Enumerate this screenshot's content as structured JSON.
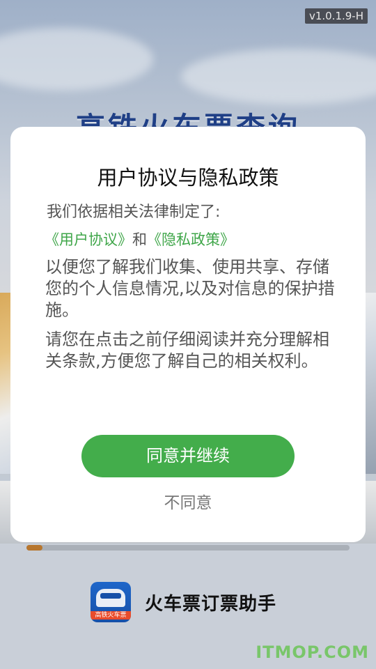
{
  "version": "v1.0.1.9-H",
  "background": {
    "title": "高铁火车票查询",
    "app_name": "火车票订票助手",
    "logo_label": "高铁火车票",
    "watermark": "ITMOP.COM",
    "progress": 0.05
  },
  "dialog": {
    "title": "用户协议与隐私政策",
    "intro": "我们依据相关法律制定了:",
    "user_agreement_link": "《用户协议》",
    "and_text": "和",
    "privacy_policy_link": "《隐私政策》",
    "paragraph1": "以便您了解我们收集、使用共享、存储您的个人信息情况,以及对信息的保护措施。",
    "paragraph2": "请您在点击之前仔细阅读并充分理解相关条款,方便您了解自己的相关权利。",
    "agree_label": "同意并继续",
    "disagree_label": "不同意"
  },
  "colors": {
    "accent_green": "#43ad4b",
    "link_green": "#3fa649",
    "logo_blue": "#1e66c9"
  }
}
